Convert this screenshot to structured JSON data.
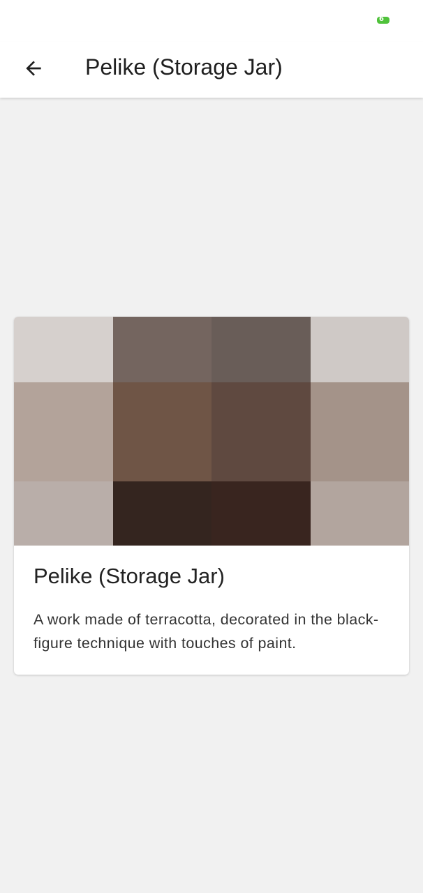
{
  "status_bar": {
    "battery_level": "6",
    "battery_color": "#4fc23a"
  },
  "app_bar": {
    "back_icon": "arrow-left-icon",
    "title": "Pelike (Storage Jar)"
  },
  "artwork_card": {
    "image_tiles": [
      [
        "#d6d0cd",
        "#74655f",
        "#695d58",
        "#cfc9c6"
      ],
      [
        "#b3a39a",
        "#6f5546",
        "#5f4940",
        "#a49389"
      ],
      [
        "#b9aea9",
        "#34251f",
        "#39251f",
        "#b2a59e"
      ]
    ],
    "title": "Pelike (Storage Jar)",
    "description": "A work made of terracotta, decorated in the black-figure technique with touches of paint."
  }
}
